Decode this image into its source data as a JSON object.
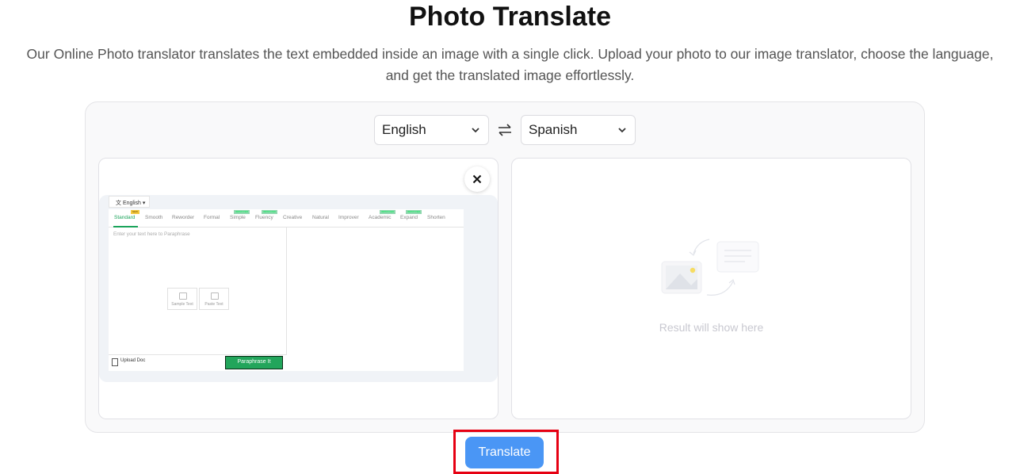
{
  "header": {
    "title": "Photo Translate",
    "subtitle_line1": "Our Online Photo translator translates the text embedded inside an image with a single click. Upload your photo to our image translator, choose the language,",
    "subtitle_line2": "and get the translated image effortlessly."
  },
  "languages": {
    "source": "English",
    "target": "Spanish"
  },
  "preview": {
    "lang": "English",
    "tabs": [
      "Standard",
      "Smooth",
      "Reworder",
      "Formal",
      "Simple",
      "Fluency",
      "Creative",
      "Natural",
      "Improver",
      "Academic",
      "Expand",
      "Shorten"
    ],
    "badge_new": "NEW",
    "badge_improved": "IMPROVED",
    "placeholder": "Enter your text here to Paraphrase",
    "sample_text": "Sample Text",
    "paste_text": "Paste Text",
    "upload_doc": "Upload Doc",
    "paraphrase_button": "Paraphrase It"
  },
  "result": {
    "placeholder": "Result will show here"
  },
  "actions": {
    "translate": "Translate"
  }
}
